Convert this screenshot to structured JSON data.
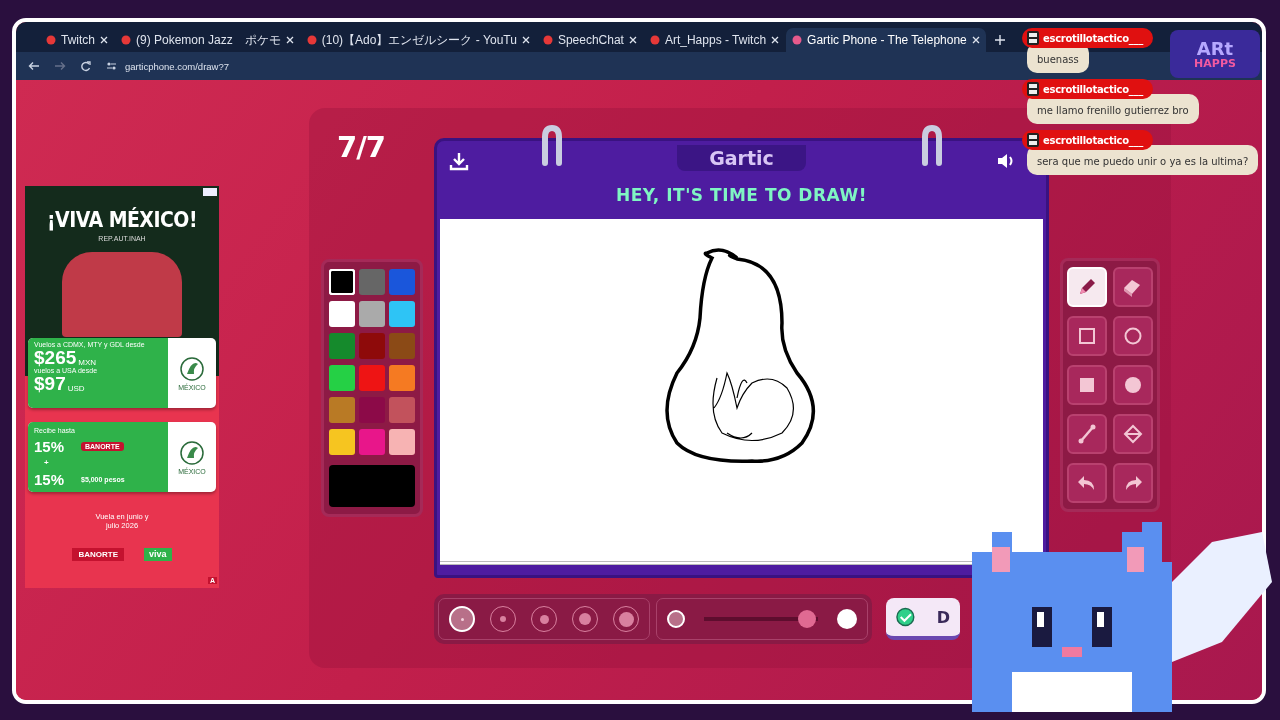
{
  "browser": {
    "tabs": [
      {
        "title": "Twitch",
        "selected": false
      },
      {
        "title": "(9) Pokemon Jazz　ポケモ",
        "selected": false
      },
      {
        "title": "(10)【Ado】エンゼルシーク - YouTu",
        "selected": false
      },
      {
        "title": "SpeechChat",
        "selected": false
      },
      {
        "title": "Art_Happs - Twitch",
        "selected": false
      },
      {
        "title": "Gartic Phone - The Telephone",
        "selected": true
      }
    ],
    "address": "garticphone.com/draw?7"
  },
  "ad": {
    "headline": "¡VIVA MÉXICO!",
    "credit": "REP.AUT.INAH",
    "ticket_1": {
      "line_1": "Vuelos a CDMX, MTY y GDL desde",
      "price_1": "$265",
      "currency_1": "MXN",
      "line_2": "vuelos a USA desde",
      "price_2": "$97",
      "currency_2": "USD",
      "crest": "MÉXICO"
    },
    "ticket_2": {
      "intro": "Recibe hasta",
      "percent_1": "15%",
      "plus": "+",
      "percent_2": "15%",
      "bank": "BANORTE",
      "amount": "$5,000 pesos",
      "crest": "MÉXICO"
    },
    "dates": "Vuela en junio y julio 2026",
    "sponsor_1": "BANORTE",
    "sponsor_2": "viva",
    "badge": "A"
  },
  "game": {
    "round": "7/7",
    "logo": "Gartic",
    "heading": "HEY, IT'S TIME TO DRAW!",
    "palette": [
      {
        "color": "#000000",
        "selected": true
      },
      {
        "color": "#666666",
        "selected": false
      },
      {
        "color": "#1a56db",
        "selected": false
      },
      {
        "color": "#ffffff",
        "selected": false
      },
      {
        "color": "#aaaaaa",
        "selected": false
      },
      {
        "color": "#2ec4f5",
        "selected": false
      },
      {
        "color": "#158a2c",
        "selected": false
      },
      {
        "color": "#8e0a0a",
        "selected": false
      },
      {
        "color": "#8b4a16",
        "selected": false
      },
      {
        "color": "#25d045",
        "selected": false
      },
      {
        "color": "#ee1414",
        "selected": false
      },
      {
        "color": "#f57a22",
        "selected": false
      },
      {
        "color": "#b97a25",
        "selected": false
      },
      {
        "color": "#8c0a48",
        "selected": false
      },
      {
        "color": "#c2525c",
        "selected": false
      },
      {
        "color": "#f6c520",
        "selected": false
      },
      {
        "color": "#e8168a",
        "selected": false
      },
      {
        "color": "#f7b3b3",
        "selected": false
      }
    ],
    "tools": [
      {
        "kind": "pen",
        "selected": true
      },
      {
        "kind": "eraser",
        "selected": false
      },
      {
        "kind": "rect",
        "selected": false
      },
      {
        "kind": "ellipse",
        "selected": false
      },
      {
        "kind": "filled-rect",
        "selected": false
      },
      {
        "kind": "filled-ellipse",
        "selected": false
      },
      {
        "kind": "line",
        "selected": false
      },
      {
        "kind": "bucket",
        "selected": false
      },
      {
        "kind": "undo",
        "selected": false
      },
      {
        "kind": "redo",
        "selected": false
      }
    ],
    "brush_sizes": [
      {
        "selected": true
      },
      {
        "selected": false
      },
      {
        "selected": false
      },
      {
        "selected": false
      },
      {
        "selected": false
      }
    ],
    "opacity": {
      "level": 0.9
    },
    "done_button": "D"
  },
  "chat": [
    {
      "user": "escrotillotactico___",
      "message": "buenass"
    },
    {
      "user": "escrotillotactico___",
      "message": "me llamo frenillo gutierrez bro"
    },
    {
      "user": "escrotillotactico___",
      "message": "sera que me puedo unir o ya es la ultima?"
    }
  ],
  "stream_logo": {
    "line_1": "ARt",
    "line_2": "HAPPS"
  }
}
